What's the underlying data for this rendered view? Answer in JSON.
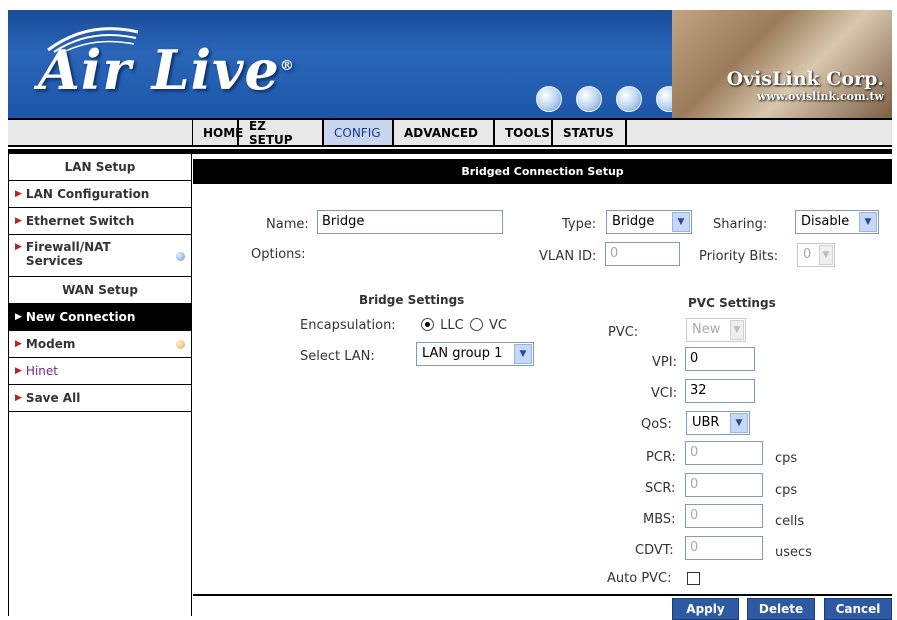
{
  "banner": {
    "logo_text": "Air Live",
    "logo_mark": "®",
    "corp_name": "OvisLink Corp.",
    "corp_url": "www.ovislink.com.tw"
  },
  "nav": {
    "tabs": [
      {
        "label": "HOME"
      },
      {
        "label": "EZ SETUP"
      },
      {
        "label": "CONFIG"
      },
      {
        "label": "ADVANCED"
      },
      {
        "label": "TOOLS"
      },
      {
        "label": "STATUS"
      }
    ],
    "active_tab": "CONFIG"
  },
  "sidebar": {
    "lan_header": "LAN Setup",
    "wan_header": "WAN Setup",
    "items": [
      {
        "label": "LAN Configuration"
      },
      {
        "label": "Ethernet Switch"
      },
      {
        "label": "Firewall/NAT Services"
      },
      {
        "label": "New Connection"
      },
      {
        "label": "Modem"
      },
      {
        "label": "Hinet"
      },
      {
        "label": "Save All"
      }
    ]
  },
  "page": {
    "title": "Bridged Connection Setup",
    "name_label": "Name:",
    "name_value": "Bridge",
    "type_label": "Type:",
    "type_value": "Bridge",
    "sharing_label": "Sharing:",
    "sharing_value": "Disable",
    "options_label": "Options:",
    "vlan_label": "VLAN ID:",
    "vlan_value": "0",
    "priority_label": "Priority Bits:",
    "priority_value": "0"
  },
  "bridge": {
    "title": "Bridge Settings",
    "encap_label": "Encapsulation:",
    "encap_options": [
      "LLC",
      "VC"
    ],
    "encap_selected": "LLC",
    "lan_label": "Select LAN:",
    "lan_value": "LAN group 1"
  },
  "pvc": {
    "title": "PVC Settings",
    "pvc_label": "PVC:",
    "pvc_value": "New",
    "vpi_label": "VPI:",
    "vpi_value": "0",
    "vci_label": "VCI:",
    "vci_value": "32",
    "qos_label": "QoS:",
    "qos_value": "UBR",
    "pcr_label": "PCR:",
    "pcr_value": "0",
    "pcr_unit": "cps",
    "scr_label": "SCR:",
    "scr_value": "0",
    "scr_unit": "cps",
    "mbs_label": "MBS:",
    "mbs_value": "0",
    "mbs_unit": "cells",
    "cdvt_label": "CDVT:",
    "cdvt_value": "0",
    "cdvt_unit": "usecs",
    "auto_label": "Auto PVC:",
    "auto_checked": false
  },
  "buttons": {
    "apply": "Apply",
    "delete": "Delete",
    "cancel": "Cancel"
  }
}
